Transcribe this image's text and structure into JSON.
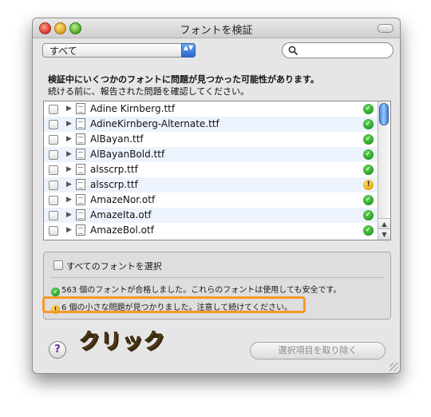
{
  "window": {
    "title": "フォントを検証"
  },
  "filter": {
    "selected": "すべて",
    "arrows": "▲▼"
  },
  "search": {
    "placeholder": "",
    "icon": "magnifier-icon"
  },
  "message": {
    "line1": "検証中にいくつかのフォントに問題が見つかった可能性があります。",
    "line2": "続ける前に、報告された問題を確認してください。"
  },
  "fonts": [
    {
      "name": "Adine Kirnberg.ttf",
      "status": "ok"
    },
    {
      "name": "AdineKirnberg-Alternate.ttf",
      "status": "ok"
    },
    {
      "name": "AlBayan.ttf",
      "status": "ok"
    },
    {
      "name": "AlBayanBold.ttf",
      "status": "ok"
    },
    {
      "name": "alsscrp.ttf",
      "status": "ok"
    },
    {
      "name": "alsscrp.ttf",
      "status": "warn"
    },
    {
      "name": "AmazeNor.otf",
      "status": "ok"
    },
    {
      "name": "AmazeIta.otf",
      "status": "ok"
    },
    {
      "name": "AmazeBol.otf",
      "status": "ok"
    }
  ],
  "status_glyphs": {
    "ok": "✓",
    "warn": "!"
  },
  "summary": {
    "select_all_label": "すべてのフォントを選択",
    "passed_text": "563 個のフォントが合格しました。これらのフォントは使用しても安全です。",
    "minor_text": "6 個の小さな問題が見つかりました。注意して続けてください。"
  },
  "annotation": {
    "text": "クリック",
    "color": "#f29a1f"
  },
  "help": {
    "label": "?"
  },
  "buttons": {
    "remove_label": "選択項目を取り除く"
  },
  "colors": {
    "ok": "#1f9a1f",
    "warn": "#e3a500",
    "highlight": "#f59a26",
    "row_alt": "#edf3fd"
  }
}
